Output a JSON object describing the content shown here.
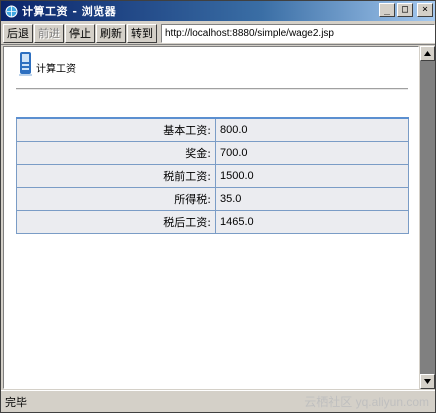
{
  "window": {
    "title": "计算工资 - 浏览器"
  },
  "toolbar": {
    "back_label": "后退",
    "forward_label": "前进",
    "stop_label": "停止",
    "refresh_label": "刷新",
    "go_label": "转到",
    "url": "http://localhost:8880/simple/wage2.jsp"
  },
  "page": {
    "title": "计算工资"
  },
  "wage_table": {
    "rows": [
      {
        "label": "基本工资:",
        "value": "800.0"
      },
      {
        "label": "奖金:",
        "value": "700.0"
      },
      {
        "label": "税前工资:",
        "value": "1500.0"
      },
      {
        "label": "所得税:",
        "value": "35.0"
      },
      {
        "label": "税后工资:",
        "value": "1465.0"
      }
    ]
  },
  "statusbar": {
    "status": "完毕",
    "watermark": "云栖社区 yq.aliyun.com"
  },
  "colors": {
    "titlebar": "#0a246a",
    "table_border": "#7a9cc6",
    "cell_bg": "#ebecf0"
  },
  "icons": {
    "title": "browser-globe-icon",
    "logo": "document-logo-icon"
  }
}
